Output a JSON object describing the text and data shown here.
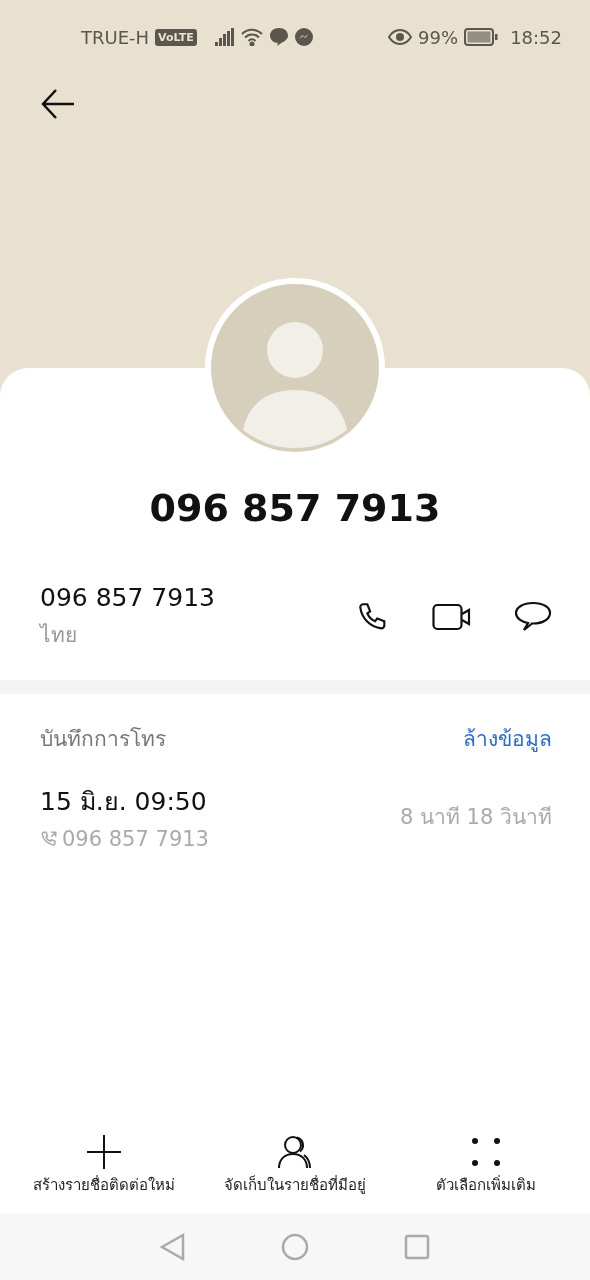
{
  "status_bar": {
    "carrier": "TRUE-H",
    "network_badge": "VoLTE",
    "battery": "99%",
    "time": "18:52"
  },
  "contact": {
    "title": "096 857 7913"
  },
  "number": {
    "value": "096 857 7913",
    "label": "ไทย",
    "actions": [
      {
        "kind": "call"
      },
      {
        "kind": "video"
      },
      {
        "kind": "message"
      }
    ]
  },
  "call_log": {
    "title": "บันทึกการโทร",
    "clear_link": "ล้างข้อมูล",
    "entries": [
      {
        "date": "15 มิ.ย. 09:50",
        "number": "096 857 7913",
        "duration": "8 นาที 18 วินาที"
      }
    ]
  },
  "bottom_actions": [
    {
      "kind": "add",
      "label": "สร้างรายชื่อติดต่อใหม่"
    },
    {
      "kind": "contacts",
      "label": "จัดเก็บในรายชื่อที่มีอยู่"
    },
    {
      "kind": "more",
      "label": "ตัวเลือกเพิ่มเติม"
    }
  ]
}
